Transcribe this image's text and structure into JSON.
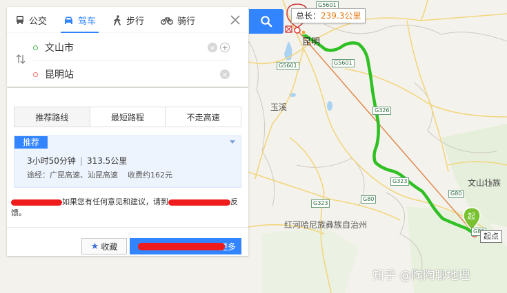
{
  "modes": [
    {
      "label": "公交",
      "icon": "bus-icon"
    },
    {
      "label": "驾车",
      "icon": "car-icon",
      "active": true
    },
    {
      "label": "步行",
      "icon": "walk-icon"
    },
    {
      "label": "骑行",
      "icon": "bike-icon"
    }
  ],
  "route_inputs": {
    "start": "文山市",
    "end": "昆明站"
  },
  "tabs": [
    "推荐路线",
    "最短路程",
    "不走高速"
  ],
  "route": {
    "badge": "推荐",
    "duration": "3小时50分钟",
    "distance": "313.5公里",
    "via": "途经：广昆高速、汕昆高速",
    "toll": "收费约162元"
  },
  "feedback": {
    "text_a": "如果您有任何意见和建议，请到",
    "text_b": "反",
    "text_c": "馈。"
  },
  "buttons": {
    "favorite": "收藏",
    "more": "更多"
  },
  "map": {
    "total_label": "总长：",
    "total_value": "239.3公里",
    "start_tag": "起点",
    "start_marker": "起",
    "places": {
      "kunming": "昆明",
      "yuxi": "玉溪",
      "wenshan": "文山壮族",
      "honghe": "红河哈尼族彝族自治州"
    },
    "roads": [
      "G5601",
      "G5601",
      "G5601",
      "G326",
      "G323",
      "G80",
      "G323",
      "G80",
      "G80"
    ]
  },
  "watermark": "知乎 @陶陶聊地理",
  "colors": {
    "accent": "#3385ff",
    "route": "#33c42a",
    "straight_line": "#e08a4f",
    "redaction": "#ee1c1c"
  }
}
